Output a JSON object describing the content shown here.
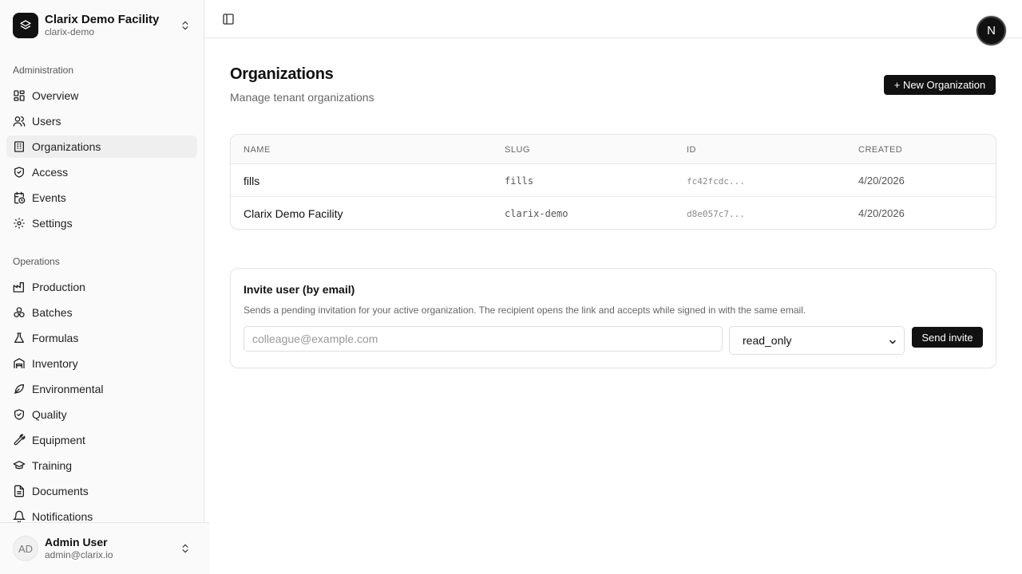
{
  "switcher": {
    "name": "Clarix Demo Facility",
    "slug": "clarix-demo",
    "logo_icon": "layers-icon",
    "chevron_icon": "chevrons-up-down-icon"
  },
  "sidebar": {
    "admin_label": "Administration",
    "admin_items": [
      {
        "label": "Overview",
        "icon": "layout-grid-icon"
      },
      {
        "label": "Users",
        "icon": "users-icon"
      },
      {
        "label": "Organizations",
        "icon": "building-icon",
        "active": true
      },
      {
        "label": "Access",
        "icon": "shield-check-icon"
      },
      {
        "label": "Events",
        "icon": "calendar-clock-icon"
      },
      {
        "label": "Settings",
        "icon": "gear-icon"
      }
    ],
    "ops_label": "Operations",
    "ops_items": [
      {
        "label": "Production",
        "icon": "factory-icon"
      },
      {
        "label": "Batches",
        "icon": "boxes-icon"
      },
      {
        "label": "Formulas",
        "icon": "flask-icon"
      },
      {
        "label": "Inventory",
        "icon": "warehouse-icon"
      },
      {
        "label": "Environmental",
        "icon": "leaf-icon"
      },
      {
        "label": "Quality",
        "icon": "shield-check-icon"
      },
      {
        "label": "Equipment",
        "icon": "wrench-icon"
      },
      {
        "label": "Training",
        "icon": "graduation-cap-icon"
      },
      {
        "label": "Documents",
        "icon": "file-text-icon"
      },
      {
        "label": "Notifications",
        "icon": "bell-icon"
      }
    ]
  },
  "user": {
    "initials": "AD",
    "name": "Admin User",
    "email": "admin@clarix.io"
  },
  "topbar": {
    "toggle_icon": "panel-left-icon",
    "badge": "N"
  },
  "page": {
    "title": "Organizations",
    "subtitle": "Manage tenant organizations",
    "new_button": "+ New Organization"
  },
  "table": {
    "headers": {
      "name": "NAME",
      "slug": "SLUG",
      "id": "ID",
      "created": "CREATED"
    },
    "rows": [
      {
        "name": "fills",
        "slug": "fills",
        "id": "fc42fcdc...",
        "created": "4/20/2026"
      },
      {
        "name": "Clarix Demo Facility",
        "slug": "clarix-demo",
        "id": "d8e057c7...",
        "created": "4/20/2026"
      }
    ]
  },
  "invite": {
    "title": "Invite user (by email)",
    "description": "Sends a pending invitation for your active organization. The recipient opens the link and accepts while signed in with the same email.",
    "email_placeholder": "colleague@example.com",
    "email_value": "",
    "role_selected": "read_only",
    "send_button": "Send invite"
  }
}
